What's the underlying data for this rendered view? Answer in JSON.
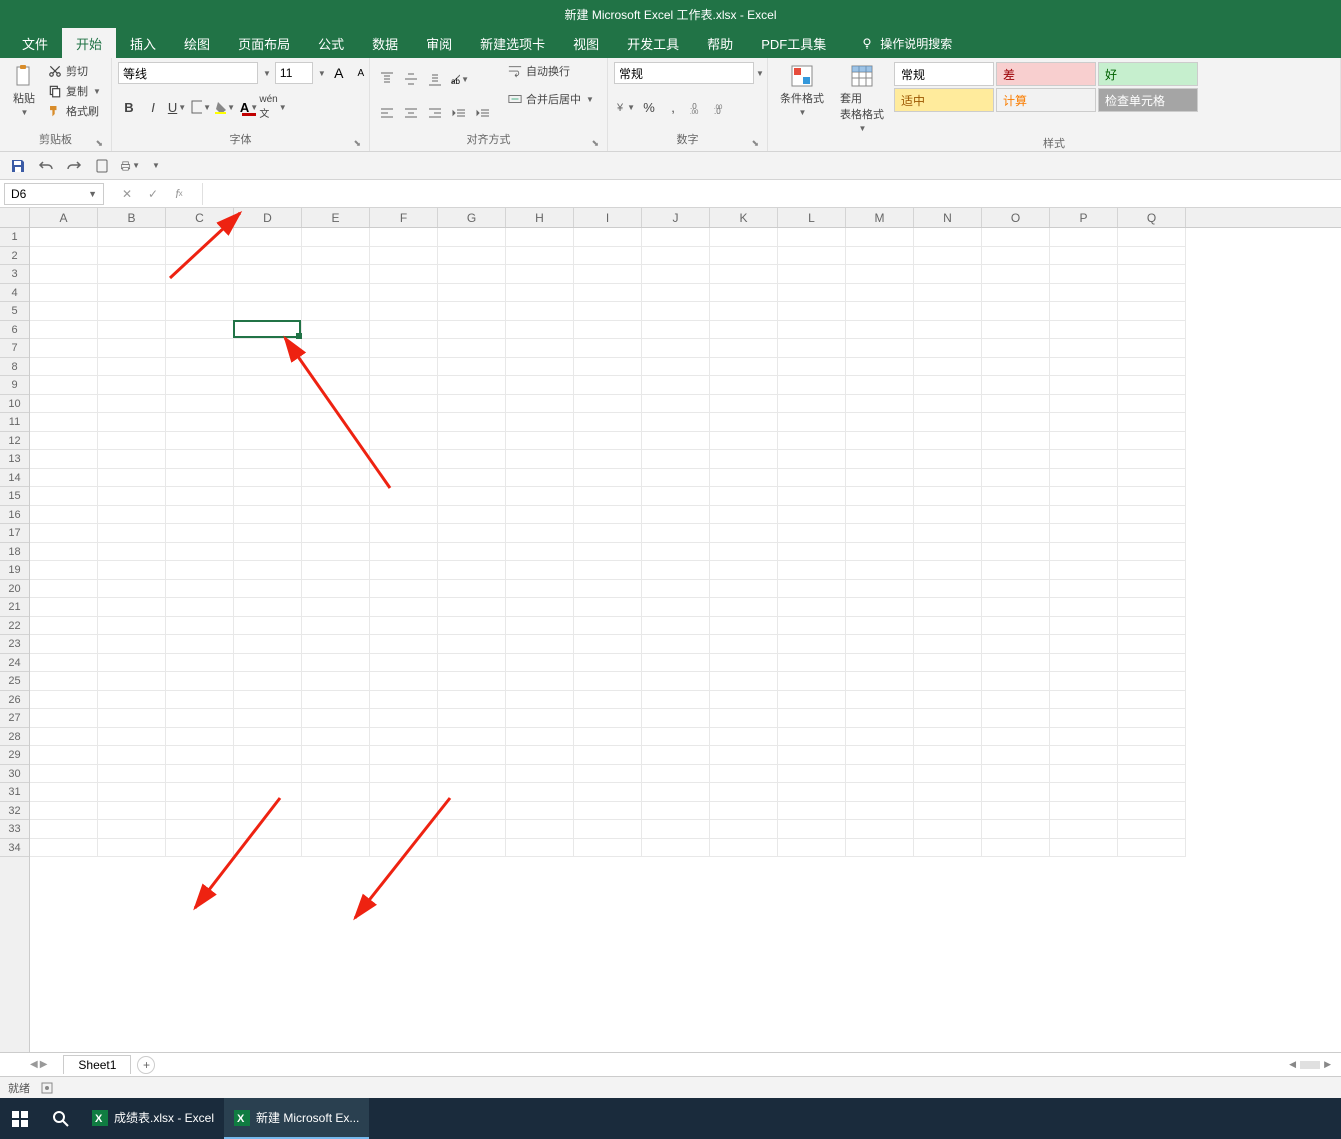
{
  "title": "新建 Microsoft Excel 工作表.xlsx  -  Excel",
  "tabs": [
    "文件",
    "开始",
    "插入",
    "绘图",
    "页面布局",
    "公式",
    "数据",
    "审阅",
    "新建选项卡",
    "视图",
    "开发工具",
    "帮助",
    "PDF工具集"
  ],
  "active_tab": "开始",
  "tell_me": "操作说明搜索",
  "clipboard": {
    "paste": "粘贴",
    "cut": "剪切",
    "copy": "复制",
    "format_painter": "格式刷",
    "label": "剪贴板"
  },
  "font": {
    "name": "等线",
    "size": "11",
    "label": "字体"
  },
  "alignment": {
    "wrap": "自动换行",
    "merge": "合并后居中",
    "label": "对齐方式"
  },
  "number": {
    "format": "常规",
    "label": "数字"
  },
  "styles": {
    "cond": "条件格式",
    "table": "套用\n表格格式",
    "normal": "常规",
    "bad": "差",
    "good": "好",
    "neutral": "适中",
    "calc": "计算",
    "check": "检查单元格",
    "label": "样式"
  },
  "name_box": "D6",
  "columns": [
    "A",
    "B",
    "C",
    "D",
    "E",
    "F",
    "G",
    "H",
    "I",
    "J",
    "K",
    "L",
    "M",
    "N",
    "O",
    "P",
    "Q"
  ],
  "rows": [
    1,
    2,
    3,
    4,
    5,
    6,
    7,
    8,
    9,
    10,
    11,
    12,
    13,
    14,
    15,
    16,
    17,
    18,
    19,
    20,
    21,
    22,
    23,
    24,
    25,
    26,
    27,
    28,
    29,
    30,
    31,
    32,
    33,
    34
  ],
  "selected": {
    "col": 3,
    "row": 5
  },
  "sheet_tab": "Sheet1",
  "status": "就绪",
  "taskbar": {
    "app1": "成绩表.xlsx - Excel",
    "app2": "新建 Microsoft Ex..."
  }
}
